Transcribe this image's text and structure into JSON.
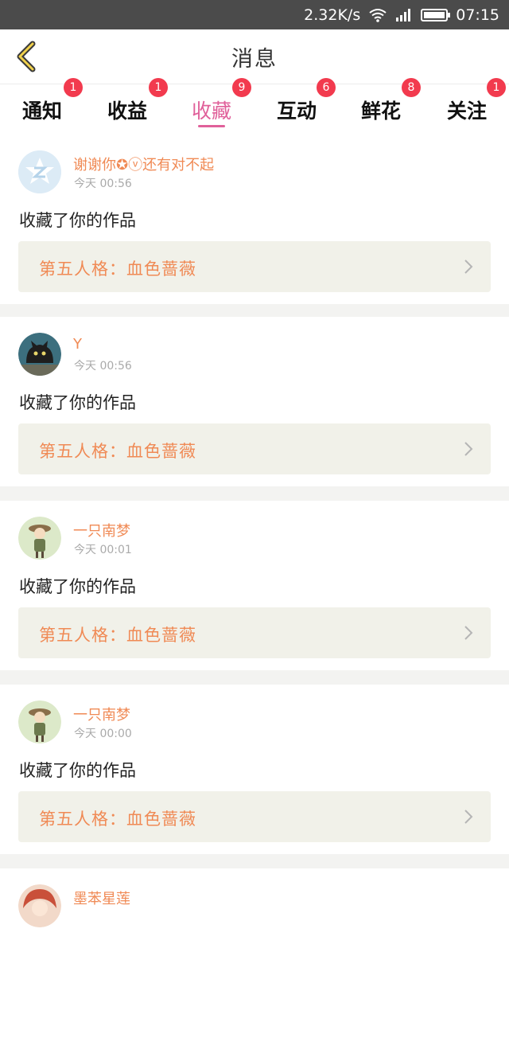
{
  "status_bar": {
    "speed": "2.32K/s",
    "time": "07:15"
  },
  "header": {
    "title": "消息"
  },
  "tabs": [
    {
      "label": "通知",
      "badge": "1"
    },
    {
      "label": "收益",
      "badge": "1"
    },
    {
      "label": "收藏",
      "badge": "9",
      "active": true
    },
    {
      "label": "互动",
      "badge": "6"
    },
    {
      "label": "鲜花",
      "badge": "8"
    },
    {
      "label": "关注",
      "badge": "1"
    }
  ],
  "feed": [
    {
      "user": "谢谢你✪ⓥ还有对不起",
      "time": "今天 00:56",
      "action": "收藏了你的作品",
      "work": "第五人格：血色蔷薇",
      "avatar": "qq-avatar-icon"
    },
    {
      "user": "Y",
      "time": "今天 00:56",
      "action": "收藏了你的作品",
      "work": "第五人格：血色蔷薇",
      "avatar": "cat-avatar"
    },
    {
      "user": "一只南梦",
      "time": "今天 00:01",
      "action": "收藏了你的作品",
      "work": "第五人格：血色蔷薇",
      "avatar": "girl-avatar"
    },
    {
      "user": "一只南梦",
      "time": "今天 00:00",
      "action": "收藏了你的作品",
      "work": "第五人格：血色蔷薇",
      "avatar": "girl-avatar"
    },
    {
      "user": "墨苯星莲",
      "time": "",
      "action": "",
      "work": "",
      "avatar": "anime-avatar"
    }
  ],
  "colors": {
    "accent": "#e0609a",
    "badge": "#f23a4e",
    "username": "#f08a55"
  }
}
